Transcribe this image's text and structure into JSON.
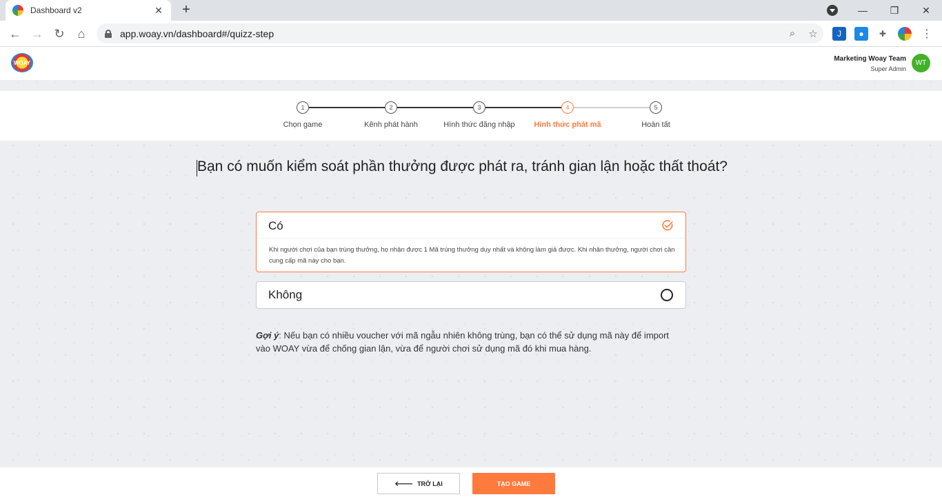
{
  "browser": {
    "tab_title": "Dashboard v2",
    "url": "app.woay.vn/dashboard#/quizz-step"
  },
  "header": {
    "logo_text": "WOAY",
    "user_name": "Marketing Woay Team",
    "user_role": "Super Admin",
    "avatar_initials": "WT"
  },
  "stepper": {
    "active_index": 3,
    "steps": [
      {
        "number": "1",
        "label": "Chọn game"
      },
      {
        "number": "2",
        "label": "Kênh phát hành"
      },
      {
        "number": "3",
        "label": "Hình thức đăng nhập"
      },
      {
        "number": "4",
        "label": "Hình thức phát mã"
      },
      {
        "number": "5",
        "label": "Hoàn tất"
      }
    ]
  },
  "main": {
    "question": "Bạn có muốn kiểm soát phần thưởng được phát ra, tránh gian lận hoặc thất thoát?",
    "options": [
      {
        "title": "Có",
        "selected": true,
        "description": "Khi người chơi của bạn trúng thưởng, họ nhận được 1 Mã trúng thưởng duy nhất và không làm giả được. Khi nhận thưởng, người chơi cần cung cấp mã này cho bạn."
      },
      {
        "title": "Không",
        "selected": false
      }
    ],
    "hint_label": "Gợi ý",
    "hint_text": ": Nếu bạn có nhiều voucher với mã ngẫu nhiên không trùng, bạn có thể sử dụng mã này để import vào WOAY vừa để chống gian lận, vừa để người chơi sử dụng mã đó khi mua hàng."
  },
  "footer": {
    "back_label": "TRỞ LẠI",
    "create_label": "TẠO GAME"
  },
  "colors": {
    "accent": "#ff7a3d",
    "avatar": "#43b02a"
  }
}
